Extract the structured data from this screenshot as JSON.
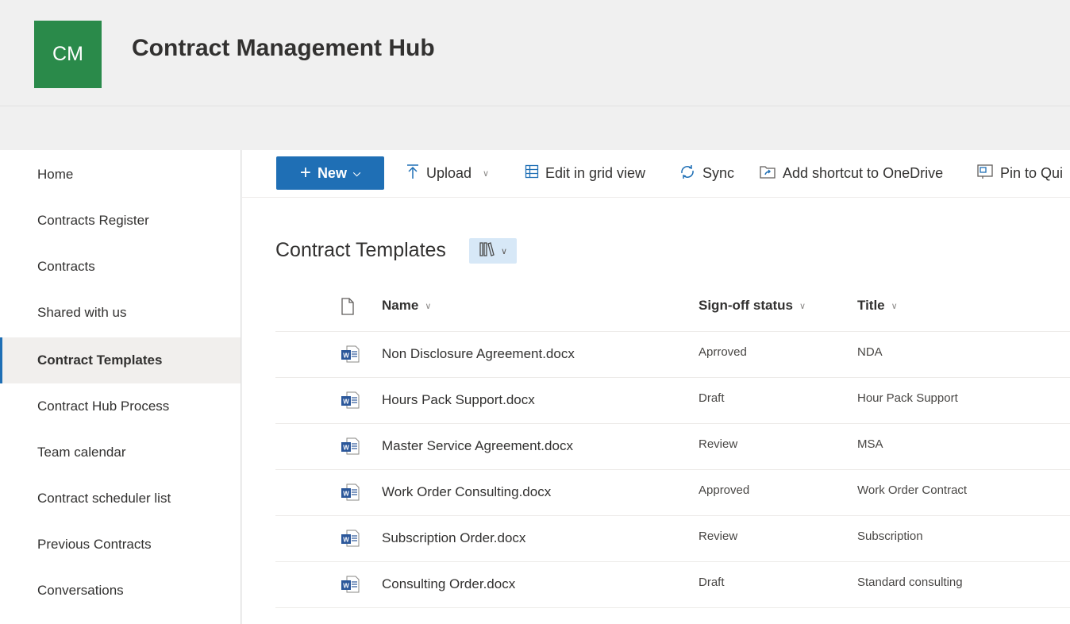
{
  "site": {
    "logo_text": "CM",
    "title": "Contract Management Hub",
    "brand_color": "#2a8a4a",
    "accent_color": "#1f6fb5"
  },
  "nav": {
    "items": [
      {
        "label": "Home"
      },
      {
        "label": "Contracts Register"
      },
      {
        "label": "Contracts"
      },
      {
        "label": "Shared with us"
      },
      {
        "label": "Contract Templates",
        "active": true
      },
      {
        "label": "Contract Hub Process"
      },
      {
        "label": "Team calendar"
      },
      {
        "label": "Contract scheduler list"
      },
      {
        "label": "Previous Contracts"
      },
      {
        "label": "Conversations"
      }
    ]
  },
  "toolbar": {
    "new_label": "New",
    "upload_label": "Upload",
    "grid_label": "Edit in grid view",
    "sync_label": "Sync",
    "shortcut_label": "Add shortcut to OneDrive",
    "pin_label": "Pin to Qui"
  },
  "library": {
    "title": "Contract Templates",
    "columns": {
      "name": "Name",
      "status": "Sign-off status",
      "title": "Title"
    },
    "rows": [
      {
        "name": "Non Disclosure Agreement.docx",
        "status": "Aprroved",
        "title": "NDA"
      },
      {
        "name": "Hours Pack Support.docx",
        "status": "Draft",
        "title": "Hour Pack Support"
      },
      {
        "name": "Master Service Agreement.docx",
        "status": "Review",
        "title": "MSA"
      },
      {
        "name": "Work Order Consulting.docx",
        "status": "Approved",
        "title": "Work Order Contract"
      },
      {
        "name": "Subscription Order.docx",
        "status": "Review",
        "title": "Subscription"
      },
      {
        "name": "Consulting Order.docx",
        "status": "Draft",
        "title": "Standard consulting"
      }
    ]
  }
}
